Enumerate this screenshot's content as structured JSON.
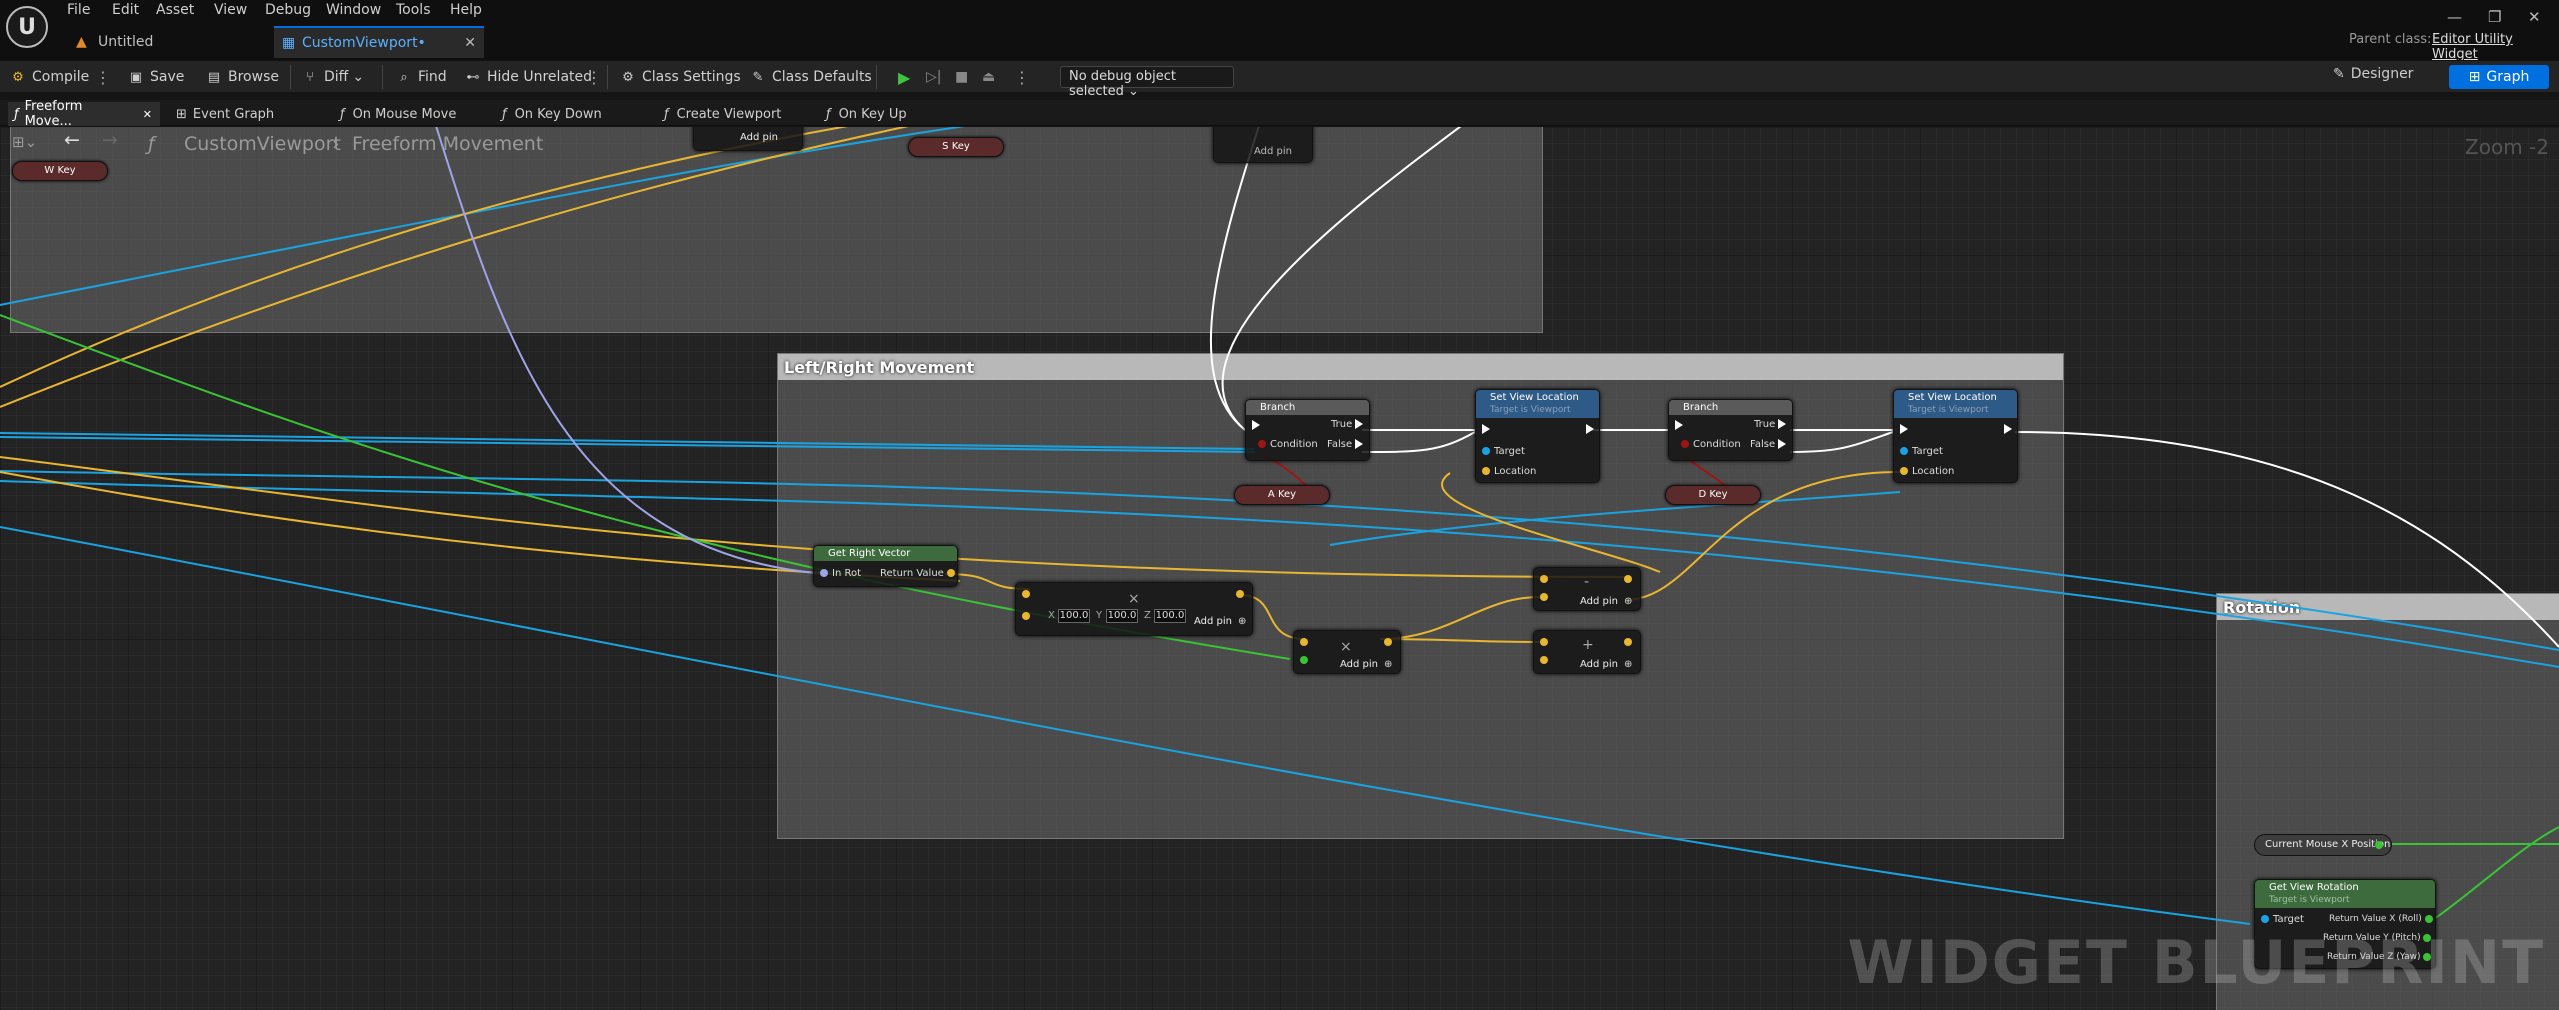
{
  "menu": [
    "File",
    "Edit",
    "Asset",
    "View",
    "Debug",
    "Window",
    "Tools",
    "Help"
  ],
  "tabs": [
    {
      "label": "Untitled"
    },
    {
      "label": "CustomViewport•"
    }
  ],
  "parent_class": {
    "label": "Parent class:",
    "value": "Editor Utility Widget"
  },
  "toolbar": {
    "compile": "Compile",
    "save": "Save",
    "browse": "Browse",
    "diff": "Diff",
    "find": "Find",
    "hide_unrelated": "Hide Unrelated",
    "class_settings": "Class Settings",
    "class_defaults": "Class Defaults",
    "debug_object": "No debug object selected",
    "designer": "Designer",
    "graph": "Graph"
  },
  "graph_tabs": [
    "Freeform Move...",
    "Event Graph",
    "On Mouse Move",
    "On Key Down",
    "Create Viewport",
    "On Key Up"
  ],
  "breadcrumb": {
    "root": "CustomViewport",
    "current": "Freeform Movement"
  },
  "zoom": "Zoom -2",
  "comments": {
    "left_right": "Left/Right Movement",
    "rotation": "Rotation"
  },
  "nodes": {
    "branch": "Branch",
    "true": "True",
    "false": "False",
    "condition": "Condition",
    "set_view_location": "Set View Location",
    "target_is_viewport": "Target is Viewport",
    "target": "Target",
    "location": "Location",
    "a_key": "A Key",
    "d_key": "D Key",
    "w_key": "W Key",
    "s_key": "S Key",
    "get_right_vector": "Get Right Vector",
    "in_rot": "In Rot",
    "return_value": "Return Value",
    "vec_x": "100.0",
    "vec_y": "100.0",
    "vec_z": "100.0",
    "x": "X",
    "y": "Y",
    "z": "Z",
    "add_pin": "Add pin",
    "minus": "-",
    "plus": "+",
    "times": "×",
    "current_mouse_x": "Current Mouse X Position",
    "get_view_rotation": "Get View Rotation",
    "ret_roll": "Return Value X (Roll)",
    "ret_pitch": "Return Value Y (Pitch)",
    "ret_yaw": "Return Value Z (Yaw)"
  },
  "watermark": "WIDGET BLUEPRINT",
  "colors": {
    "accent": "#0070e0",
    "exec": "#ffffff",
    "vector": "#e8b630",
    "object": "#1aa3e0",
    "bool": "#9e1515",
    "float": "#39c435"
  }
}
